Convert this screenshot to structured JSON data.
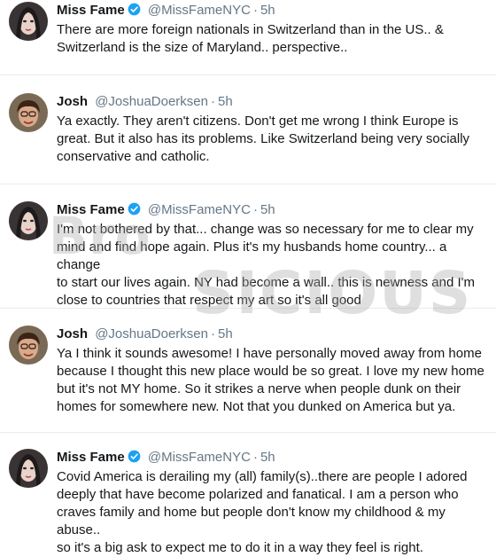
{
  "tweets": [
    {
      "name": "Miss Fame",
      "handle": "@MissFameNYC",
      "time": "5h",
      "verified": true,
      "lines": [
        "There are more foreign nationals in Switzerland than in the US.. &",
        "Switzerland is the size of Maryland.. perspective.."
      ]
    },
    {
      "name": "Josh",
      "handle": "@JoshuaDoerksen",
      "time": "5h",
      "verified": false,
      "lines": [
        "Ya exactly.  They aren't citizens.  Don't get me wrong I think Europe is",
        "great.  But it also has its problems.  Like Switzerland being very socially",
        "conservative and catholic."
      ]
    },
    {
      "name": "Miss Fame",
      "handle": "@MissFameNYC",
      "time": "5h",
      "verified": true,
      "lines": [
        "I'm not bothered by that... change was so necessary for me to clear my",
        "mind and find hope again. Plus it's my husbands home country... a change",
        "to start our lives again. NY had become a wall.. this is newness and I'm",
        "close to countries that respect my art so it's all good"
      ]
    },
    {
      "name": "Josh",
      "handle": "@JoshuaDoerksen",
      "time": "5h",
      "verified": false,
      "lines": [
        "Ya I think it sounds awesome! I have personally moved away from home",
        "because I thought this new place would be so great.  I love my new home",
        "but it's not MY home.  So it strikes a nerve when people dunk on their",
        "homes for somewhere new.  Not that you dunked on America but ya."
      ]
    },
    {
      "name": "Miss Fame",
      "handle": "@MissFameNYC",
      "time": "5h",
      "verified": true,
      "lines": [
        "Covid America is derailing my (all) family(s)..there are people I adored",
        "deeply that have become polarized and fanatical. I am a person who",
        "craves family and home but people don't know my childhood & my abuse..",
        "so it's a big ask to expect me to do it in a way they feel is right."
      ]
    }
  ],
  "separator": "·",
  "watermark": {
    "line1": "Bro",
    "line2": "SICIOUS"
  },
  "colors": {
    "text": "#14171a",
    "secondary": "#657786",
    "verified": "#1da1f2",
    "divider": "#e6ecf0"
  }
}
